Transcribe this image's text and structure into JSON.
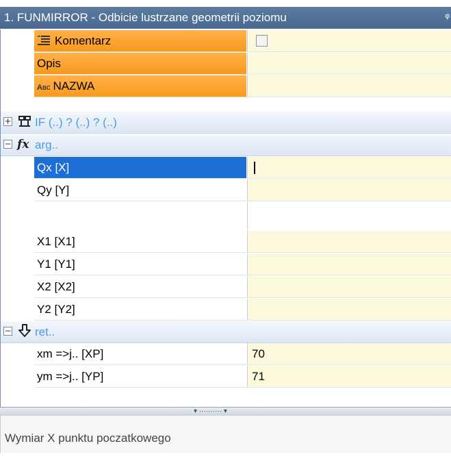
{
  "window": {
    "title": "1. FUNMIRROR - Odbicie lustrzane geometrii poziomu",
    "pin_glyph": "ᵠ"
  },
  "properties": {
    "top_rows": [
      {
        "label": "Komentarz",
        "icon": "comment-list-icon",
        "value_type": "checkbox"
      },
      {
        "label": "Opis",
        "icon": "",
        "value_type": "text",
        "value": ""
      },
      {
        "label": "NAZWA",
        "icon": "abc-icon",
        "icon_text": "Abc",
        "value_type": "text",
        "value": ""
      }
    ],
    "groups": {
      "if": {
        "label": "IF (..) ? (..) ? (..)",
        "toggle": "+",
        "icon": "condition-icon"
      },
      "arg": {
        "label": "arg..",
        "toggle": "−",
        "icon": "function-icon",
        "icon_text": "fx"
      },
      "ret": {
        "label": "ret..",
        "toggle": "−",
        "icon": "return-icon"
      }
    },
    "arg_rows": [
      {
        "label": "Qx [X]",
        "value": "",
        "selected": true
      },
      {
        "label": "Qy [Y]",
        "value": ""
      },
      {
        "label": "X1 [X1]",
        "value": ""
      },
      {
        "label": "Y1 [Y1]",
        "value": ""
      },
      {
        "label": "X2 [X2]",
        "value": ""
      },
      {
        "label": "Y2 [Y2]",
        "value": ""
      }
    ],
    "ret_rows": [
      {
        "label": "xm =>j.. [XP]",
        "value": "70"
      },
      {
        "label": "ym =>j.. [YP]",
        "value": "71"
      }
    ]
  },
  "splitter": {
    "grip": "▾ ·········· ▾"
  },
  "status": {
    "description": "Wymiar X punktu poczatkowego"
  },
  "colors": {
    "title_bg": "#4f6f96",
    "orange_label": "#f89a1e",
    "selected": "#1d6fd6",
    "value_bg": "#fdf9dc",
    "group_text": "#4a9ae8"
  }
}
